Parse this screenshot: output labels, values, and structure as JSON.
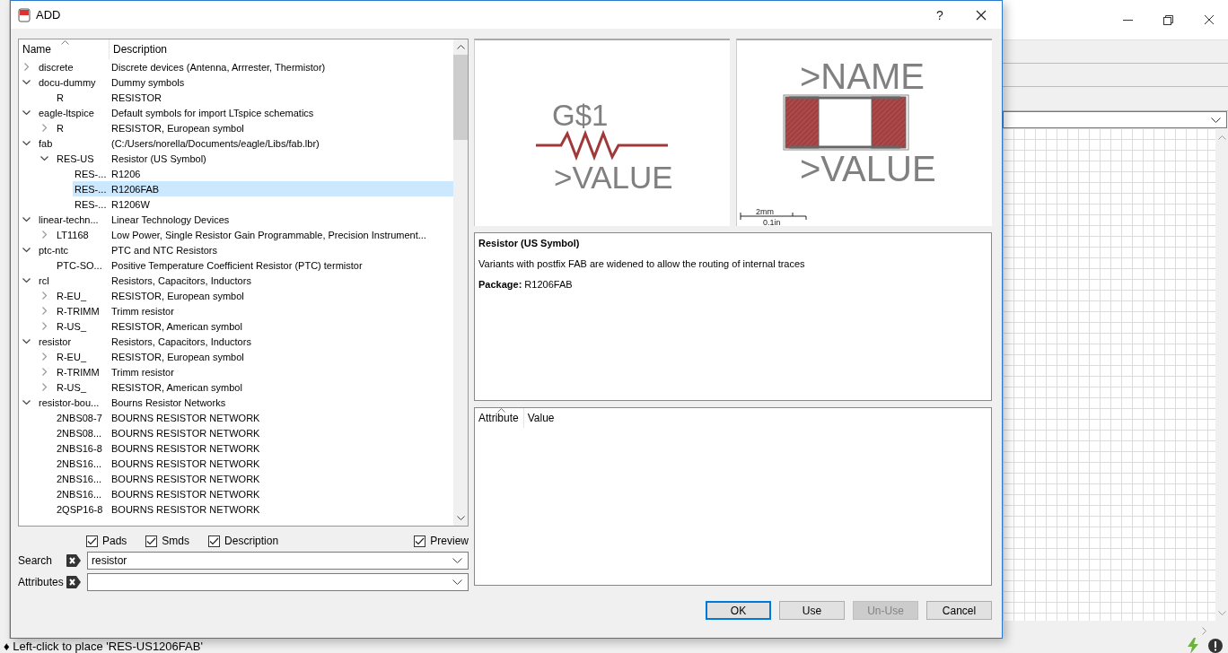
{
  "dialog": {
    "title": "ADD",
    "help": "?"
  },
  "tree": {
    "columns": [
      "Name",
      "Description"
    ],
    "rows": [
      {
        "name": "discrete",
        "description": "Discrete devices (Antenna, Arrrester, Thermistor)",
        "expanded": false,
        "selected": false
      },
      {
        "name": "docu-dummy",
        "description": "Dummy symbols",
        "expanded": true,
        "selected": false,
        "children": [
          {
            "name": "R",
            "description": "RESISTOR",
            "selected": false
          }
        ]
      },
      {
        "name": "eagle-ltspice",
        "description": "Default symbols for import LTspice schematics",
        "expanded": true,
        "selected": false,
        "children": [
          {
            "name": "R",
            "description": "RESISTOR, European symbol",
            "expanded": false,
            "selected": false
          }
        ]
      },
      {
        "name": "fab",
        "description": "(C:/Users/norella/Documents/eagle/Libs/fab.lbr)",
        "expanded": true,
        "selected": false,
        "children": [
          {
            "name": "RES-US",
            "description": "Resistor (US Symbol)",
            "expanded": true,
            "selected": false,
            "children": [
              {
                "name": "RES-...",
                "description": "R1206",
                "selected": false
              },
              {
                "name": "RES-...",
                "description": "R1206FAB",
                "selected": true
              },
              {
                "name": "RES-...",
                "description": "R1206W",
                "selected": false
              }
            ]
          }
        ]
      },
      {
        "name": "linear-techn...",
        "description": "Linear Technology Devices",
        "expanded": true,
        "selected": false,
        "children": [
          {
            "name": "LT1168",
            "description": "Low Power, Single Resistor Gain Programmable, Precision Instrument...",
            "expanded": false,
            "selected": false
          }
        ]
      },
      {
        "name": "ptc-ntc",
        "description": "PTC and NTC Resistors",
        "expanded": true,
        "selected": false,
        "children": [
          {
            "name": "PTC-SO...",
            "description": "Positive Temperature Coefficient Resistor (PTC) termistor",
            "selected": false
          }
        ]
      },
      {
        "name": "rcl",
        "description": "Resistors, Capacitors, Inductors",
        "expanded": true,
        "selected": false,
        "children": [
          {
            "name": "R-EU_",
            "description": "RESISTOR, European symbol",
            "expanded": false,
            "selected": false
          },
          {
            "name": "R-TRIMM",
            "description": "Trimm resistor",
            "expanded": false,
            "selected": false
          },
          {
            "name": "R-US_",
            "description": "RESISTOR, American symbol",
            "expanded": false,
            "selected": false
          }
        ]
      },
      {
        "name": "resistor",
        "description": "Resistors, Capacitors, Inductors",
        "expanded": true,
        "selected": false,
        "children": [
          {
            "name": "R-EU_",
            "description": "RESISTOR, European symbol",
            "expanded": false,
            "selected": false
          },
          {
            "name": "R-TRIMM",
            "description": "Trimm resistor",
            "expanded": false,
            "selected": false
          },
          {
            "name": "R-US_",
            "description": "RESISTOR, American symbol",
            "expanded": false,
            "selected": false
          }
        ]
      },
      {
        "name": "resistor-bou...",
        "description": "Bourns Resistor Networks",
        "expanded": true,
        "selected": false,
        "children": [
          {
            "name": "2NBS08-7",
            "description": "BOURNS RESISTOR NETWORK",
            "selected": false
          },
          {
            "name": "2NBS08...",
            "description": "BOURNS RESISTOR NETWORK",
            "selected": false
          },
          {
            "name": "2NBS16-8",
            "description": "BOURNS RESISTOR NETWORK",
            "selected": false
          },
          {
            "name": "2NBS16...",
            "description": "BOURNS RESISTOR NETWORK",
            "selected": false
          },
          {
            "name": "2NBS16...",
            "description": "BOURNS RESISTOR NETWORK",
            "selected": false
          },
          {
            "name": "2NBS16...",
            "description": "BOURNS RESISTOR NETWORK",
            "selected": false
          },
          {
            "name": "2QSP16-8",
            "description": "BOURNS RESISTOR NETWORK",
            "selected": false
          }
        ]
      }
    ]
  },
  "options": [
    {
      "label": "Pads",
      "checked": true
    },
    {
      "label": "Smds",
      "checked": true
    },
    {
      "label": "Description",
      "checked": true
    },
    {
      "label": "Preview",
      "checked": true
    }
  ],
  "search": {
    "label": "Search",
    "value": "resistor"
  },
  "attributes_filter": {
    "label": "Attributes"
  },
  "symbol_preview": {
    "name": "G$1",
    "value": ">VALUE"
  },
  "package_preview": {
    "name": ">NAME",
    "value": ">VALUE",
    "scale_metric": "2mm",
    "scale_imperial": "0.1in"
  },
  "details": {
    "title": "Resistor (US Symbol)",
    "text": "Variants with postfix FAB are widened to allow the routing of internal traces",
    "package": "**Package:** R1206FAB"
  },
  "attribute_table": {
    "columns": [
      "Attribute",
      "Value"
    ]
  },
  "buttons": [
    {
      "label": "OK",
      "default": true,
      "disabled": false
    },
    {
      "label": "Use",
      "default": false,
      "disabled": false
    },
    {
      "label": "Un-Use",
      "default": false,
      "disabled": true
    },
    {
      "label": "Cancel",
      "default": false,
      "disabled": false
    }
  ],
  "status_bar": {
    "text": "♦ Left-click to place 'RES-US1206FAB'"
  }
}
